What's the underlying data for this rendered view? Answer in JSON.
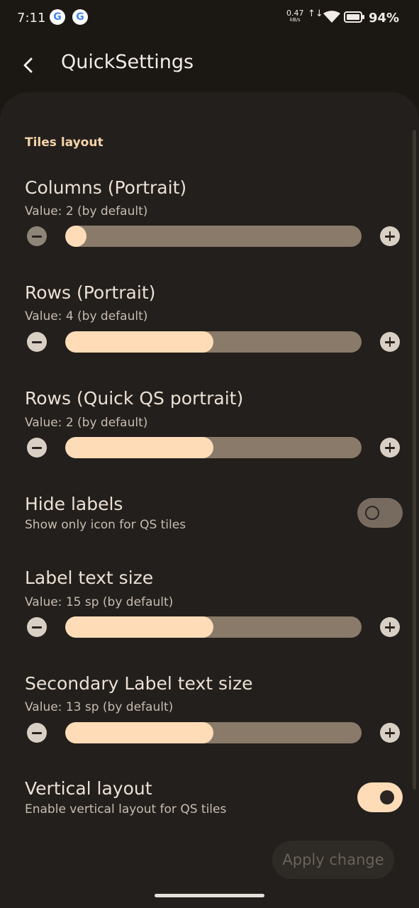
{
  "status_bar": {
    "time": "7:11",
    "net_speed": "0.47",
    "net_unit": "kB/s",
    "battery_percent": "94%"
  },
  "app_bar": {
    "title": "QuickSettings",
    "back_icon": "arrow-back-icon"
  },
  "section": {
    "title": "Tiles layout"
  },
  "settings": {
    "columns_portrait": {
      "title": "Columns (Portrait)",
      "value_text": "Value: 2 (by default)",
      "fraction": 0.0
    },
    "rows_portrait": {
      "title": "Rows (Portrait)",
      "value_text": "Value: 4 (by default)",
      "fraction": 0.5
    },
    "rows_quick_qs": {
      "title": "Rows (Quick QS portrait)",
      "value_text": "Value: 2 (by default)",
      "fraction": 0.5
    },
    "hide_labels": {
      "title": "Hide labels",
      "subtitle": "Show only icon for QS tiles",
      "enabled": false
    },
    "label_text_size": {
      "title": "Label text size",
      "value_text": "Value: 15 sp (by default)",
      "fraction": 0.5
    },
    "secondary_label_text_size": {
      "title": "Secondary Label text size",
      "value_text": "Value: 13 sp (by default)",
      "fraction": 0.5
    },
    "vertical_layout": {
      "title": "Vertical layout",
      "subtitle": "Enable vertical layout for QS tiles",
      "enabled": true
    }
  },
  "apply_button": {
    "label": "Apply change"
  },
  "colors": {
    "background": "#1b1713",
    "panel": "#221f1c",
    "accent": "#ffdcb8",
    "track": "#8a7a69",
    "section_title": "#f6d3aa"
  }
}
